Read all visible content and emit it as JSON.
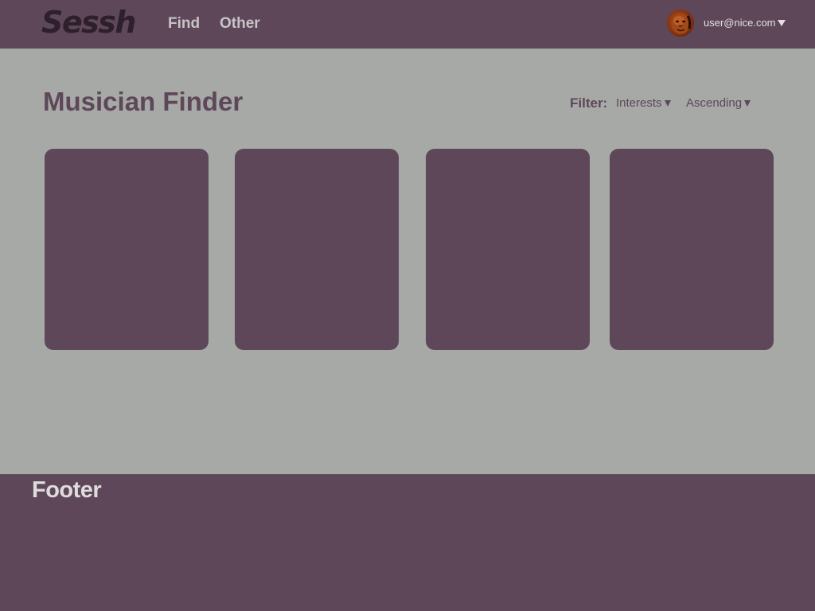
{
  "header": {
    "logo": "Sessh",
    "nav": [
      {
        "label": "Find"
      },
      {
        "label": "Other"
      }
    ],
    "user": {
      "email": "user@nice.com",
      "avatar_icon": "user-avatar-photo"
    }
  },
  "main": {
    "title": "Musician Finder",
    "filter": {
      "label": "Filter:",
      "interests": "Interests",
      "order": "Ascending"
    },
    "card_count": 4
  },
  "footer": {
    "title": "Footer"
  },
  "colors": {
    "primary": "#5e4759",
    "background": "#a6a9a6",
    "logo": "#2e1f2c",
    "nav_text": "#c7c4c6"
  }
}
